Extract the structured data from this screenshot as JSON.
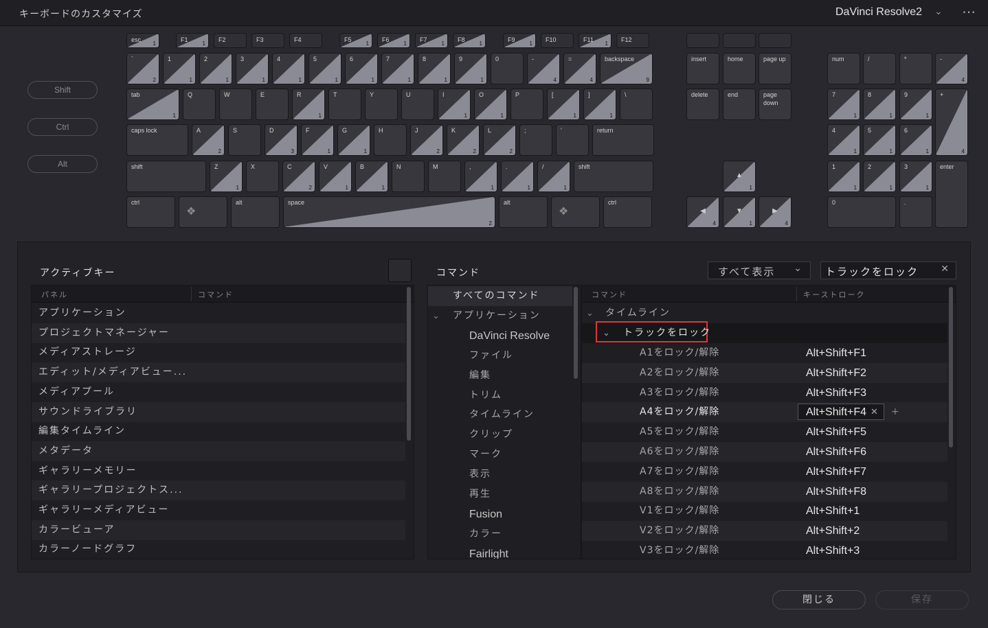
{
  "window": {
    "title": "キーボードのカスタマイズ",
    "preset": "DaVinci Resolve2"
  },
  "modifiers": [
    "Shift",
    "Ctrl",
    "Alt"
  ],
  "keyboard": {
    "fkeys": [
      {
        "label": "esc",
        "count": "1"
      },
      {
        "label": "F1",
        "count": "1"
      },
      {
        "label": "F2",
        "count": ""
      },
      {
        "label": "F3",
        "count": ""
      },
      {
        "label": "F4",
        "count": ""
      },
      {
        "label": "F5",
        "count": "1"
      },
      {
        "label": "F6",
        "count": "1"
      },
      {
        "label": "F7",
        "count": "1"
      },
      {
        "label": "F8",
        "count": "1"
      },
      {
        "label": "F9",
        "count": "1"
      },
      {
        "label": "F10",
        "count": ""
      },
      {
        "label": "F11",
        "count": "1"
      },
      {
        "label": "F12",
        "count": ""
      }
    ],
    "row1": [
      {
        "label": "`",
        "count": "2"
      },
      {
        "label": "1",
        "count": "1"
      },
      {
        "label": "2",
        "count": "1"
      },
      {
        "label": "3",
        "count": "1"
      },
      {
        "label": "4",
        "count": "1"
      },
      {
        "label": "5",
        "count": "1"
      },
      {
        "label": "6",
        "count": "1"
      },
      {
        "label": "7",
        "count": "1"
      },
      {
        "label": "8",
        "count": "1"
      },
      {
        "label": "9",
        "count": "1"
      },
      {
        "label": "0",
        "count": ""
      },
      {
        "label": "-",
        "count": "4"
      },
      {
        "label": "=",
        "count": "4"
      },
      {
        "label": "backspace",
        "count": "9"
      }
    ],
    "row2": [
      {
        "label": "tab",
        "count": "1"
      },
      {
        "label": "Q",
        "count": ""
      },
      {
        "label": "W",
        "count": ""
      },
      {
        "label": "E",
        "count": ""
      },
      {
        "label": "R",
        "count": "1"
      },
      {
        "label": "T",
        "count": ""
      },
      {
        "label": "Y",
        "count": ""
      },
      {
        "label": "U",
        "count": ""
      },
      {
        "label": "I",
        "count": "1"
      },
      {
        "label": "O",
        "count": "1"
      },
      {
        "label": "P",
        "count": ""
      },
      {
        "label": "[",
        "count": "1"
      },
      {
        "label": "]",
        "count": "1"
      },
      {
        "label": "\\",
        "count": ""
      }
    ],
    "row3": [
      {
        "label": "caps lock",
        "count": ""
      },
      {
        "label": "A",
        "count": "2"
      },
      {
        "label": "S",
        "count": ""
      },
      {
        "label": "D",
        "count": "3"
      },
      {
        "label": "F",
        "count": "1"
      },
      {
        "label": "G",
        "count": "1"
      },
      {
        "label": "H",
        "count": ""
      },
      {
        "label": "J",
        "count": "2"
      },
      {
        "label": "K",
        "count": "2"
      },
      {
        "label": "L",
        "count": "2"
      },
      {
        "label": ";",
        "count": ""
      },
      {
        "label": "'",
        "count": ""
      },
      {
        "label": "return",
        "count": ""
      }
    ],
    "row4": [
      {
        "label": "shift",
        "count": ""
      },
      {
        "label": "Z",
        "count": "1"
      },
      {
        "label": "X",
        "count": ""
      },
      {
        "label": "C",
        "count": "2"
      },
      {
        "label": "V",
        "count": "1"
      },
      {
        "label": "B",
        "count": "1"
      },
      {
        "label": "N",
        "count": ""
      },
      {
        "label": "M",
        "count": ""
      },
      {
        "label": ",",
        "count": "1"
      },
      {
        "label": ".",
        "count": "1"
      },
      {
        "label": "/",
        "count": "1"
      },
      {
        "label": "shift",
        "count": ""
      }
    ],
    "row5": [
      {
        "label": "ctrl",
        "count": ""
      },
      {
        "label": "❖",
        "count": ""
      },
      {
        "label": "alt",
        "count": ""
      },
      {
        "label": "space",
        "count": "2"
      },
      {
        "label": "alt",
        "count": ""
      },
      {
        "label": "❖",
        "count": ""
      },
      {
        "label": "ctrl",
        "count": ""
      }
    ],
    "nav": [
      {
        "label": "insert",
        "count": ""
      },
      {
        "label": "home",
        "count": ""
      },
      {
        "label": "page up",
        "count": ""
      },
      {
        "label": "delete",
        "count": ""
      },
      {
        "label": "end",
        "count": ""
      },
      {
        "label": "page\ndown",
        "count": ""
      }
    ],
    "arrows": [
      {
        "label": "▲",
        "count": "1"
      },
      {
        "label": "◀",
        "count": "4"
      },
      {
        "label": "▼",
        "count": "1"
      },
      {
        "label": "▶",
        "count": "4"
      }
    ],
    "numpad": [
      {
        "label": "num",
        "count": ""
      },
      {
        "label": "/",
        "count": ""
      },
      {
        "label": "*",
        "count": ""
      },
      {
        "label": "-",
        "count": "4"
      },
      {
        "label": "7",
        "count": "1"
      },
      {
        "label": "8",
        "count": "1"
      },
      {
        "label": "9",
        "count": "1"
      },
      {
        "label": "+",
        "count": "4"
      },
      {
        "label": "4",
        "count": "1"
      },
      {
        "label": "5",
        "count": "1"
      },
      {
        "label": "6",
        "count": "1"
      },
      {
        "label": "1",
        "count": "1"
      },
      {
        "label": "2",
        "count": "1"
      },
      {
        "label": "3",
        "count": "1"
      },
      {
        "label": "enter",
        "count": ""
      },
      {
        "label": "0",
        "count": ""
      },
      {
        "label": ".",
        "count": ""
      }
    ]
  },
  "active_keys": {
    "title": "アクティブキー",
    "col_panel": "パネル",
    "col_command": "コマンド",
    "rows": [
      "アプリケーション",
      "プロジェクトマネージャー",
      "メディアストレージ",
      "エディット/メディアビュー...",
      "メディアプール",
      "サウンドライブラリ",
      "編集タイムライン",
      "メタデータ",
      "ギャラリーメモリー",
      "ギャラリープロジェクトス...",
      "ギャラリーメディアビュー",
      "カラービューア",
      "カラーノードグラフ"
    ]
  },
  "commands": {
    "title": "コマンド",
    "filter": "すべて表示",
    "search_value": "トラックをロック",
    "tree": [
      {
        "label": "すべてのコマンド",
        "level": 0,
        "selected": true
      },
      {
        "label": "アプリケーション",
        "level": 0,
        "expanded": true
      },
      {
        "label": "DaVinci Resolve",
        "level": 1
      },
      {
        "label": "ファイル",
        "level": 1
      },
      {
        "label": "編集",
        "level": 1
      },
      {
        "label": "トリム",
        "level": 1
      },
      {
        "label": "タイムライン",
        "level": 1
      },
      {
        "label": "クリップ",
        "level": 1
      },
      {
        "label": "マーク",
        "level": 1
      },
      {
        "label": "表示",
        "level": 1
      },
      {
        "label": "再生",
        "level": 1
      },
      {
        "label": "Fusion",
        "level": 1
      },
      {
        "label": "カラー",
        "level": 1
      },
      {
        "label": "Fairlight",
        "level": 1
      }
    ],
    "col_command": "コマンド",
    "col_keystroke": "キーストローク",
    "group": "タイムライン",
    "subgroup": "トラックをロック",
    "items": [
      {
        "name": "A1をロック/解除",
        "key": "Alt+Shift+F1"
      },
      {
        "name": "A2をロック/解除",
        "key": "Alt+Shift+F2"
      },
      {
        "name": "A3をロック/解除",
        "key": "Alt+Shift+F3"
      },
      {
        "name": "A4をロック/解除",
        "key": "Alt+Shift+F4",
        "editing": true
      },
      {
        "name": "A5をロック/解除",
        "key": "Alt+Shift+F5"
      },
      {
        "name": "A6をロック/解除",
        "key": "Alt+Shift+F6"
      },
      {
        "name": "A7をロック/解除",
        "key": "Alt+Shift+F7"
      },
      {
        "name": "A8をロック/解除",
        "key": "Alt+Shift+F8"
      },
      {
        "name": "V1をロック/解除",
        "key": "Alt+Shift+1"
      },
      {
        "name": "V2をロック/解除",
        "key": "Alt+Shift+2"
      },
      {
        "name": "V3をロック/解除",
        "key": "Alt+Shift+3"
      }
    ]
  },
  "buttons": {
    "close": "閉じる",
    "save": "保存"
  },
  "colors": {
    "highlight_box": "#e03535",
    "key_fill": "#8b8b95"
  }
}
